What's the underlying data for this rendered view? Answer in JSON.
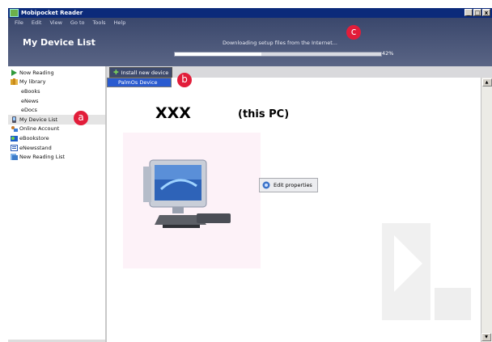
{
  "window": {
    "title": "Mobipocket Reader",
    "controls": [
      "_",
      "□",
      "x"
    ]
  },
  "menu": [
    "File",
    "Edit",
    "View",
    "Go to",
    "Tools",
    "Help"
  ],
  "header": {
    "title": "My Device List",
    "download_status": "Downloading setup files from the Internet...",
    "progress_percent": 42,
    "progress_label": "42%"
  },
  "sidebar": {
    "items": [
      {
        "label": "Now Reading",
        "icon": "play-arrow-icon"
      },
      {
        "label": "My library",
        "icon": "books-icon"
      },
      {
        "label": "eBooks",
        "icon": "none"
      },
      {
        "label": "eNews",
        "icon": "none"
      },
      {
        "label": "eDocs",
        "icon": "none"
      },
      {
        "label": "My Device List",
        "icon": "device-icon"
      },
      {
        "label": "Online Account",
        "icon": "account-icon"
      },
      {
        "label": "eBookstore",
        "icon": "store-icon"
      },
      {
        "label": "eNewsstand",
        "icon": "newsstand-icon"
      },
      {
        "label": "New Reading List",
        "icon": "list-icon"
      }
    ]
  },
  "toolbar": {
    "install_label": "Install new device"
  },
  "dropdown": {
    "items": [
      "PalmOs Device"
    ]
  },
  "device": {
    "name": "XXX",
    "suffix": "(this PC)",
    "edit_label": "Edit properties"
  },
  "callouts": [
    "a",
    "b",
    "c"
  ],
  "colors": {
    "header_bg": "#3a476c",
    "titlebar_bg": "#0b2a7a",
    "callout": "#e21d3a",
    "selection": "#2a5bd0"
  }
}
